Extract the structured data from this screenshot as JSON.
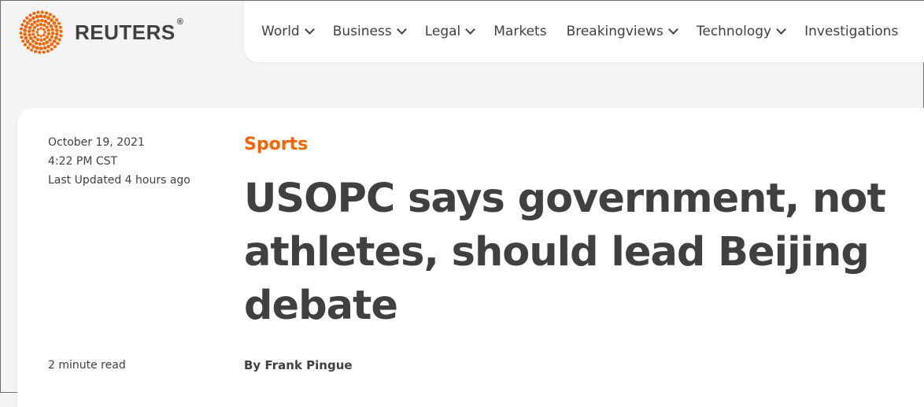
{
  "header": {
    "brand": "REUTERS",
    "brand_mark": "®",
    "brand_color": "#fa6400",
    "nav_items": [
      {
        "label": "World",
        "has_dropdown": true
      },
      {
        "label": "Business",
        "has_dropdown": true
      },
      {
        "label": "Legal",
        "has_dropdown": true
      },
      {
        "label": "Markets",
        "has_dropdown": false
      },
      {
        "label": "Breakingviews",
        "has_dropdown": true
      },
      {
        "label": "Technology",
        "has_dropdown": true
      },
      {
        "label": "Investigations",
        "has_dropdown": false
      }
    ]
  },
  "article": {
    "date": "October 19, 2021",
    "time": "4:22 PM CST",
    "updated": "Last Updated 4 hours ago",
    "read_time": "2 minute read",
    "section": "Sports",
    "section_color": "#fa6400",
    "headline": "USOPC says government, not athletes, should lead Beijing debate",
    "byline_prefix": "By",
    "author": "Frank Pingue"
  }
}
